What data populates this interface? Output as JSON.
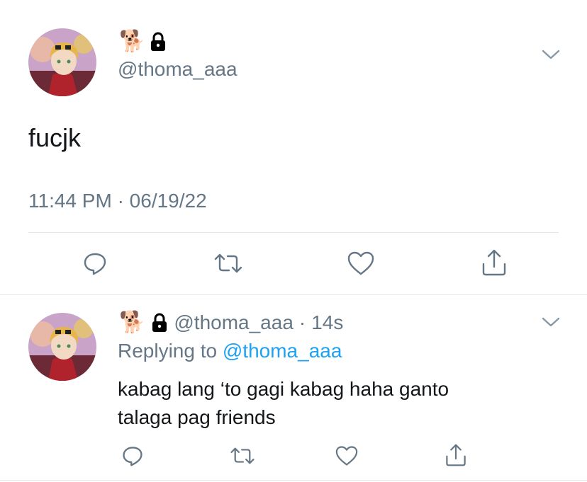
{
  "main_tweet": {
    "name_emoji": "🐕",
    "handle": "@thoma_aaa",
    "text": "fucjk",
    "time": "11:44 PM",
    "separator": "·",
    "date": "06/19/22"
  },
  "reply": {
    "name_emoji": "🐕",
    "handle": "@thoma_aaa",
    "dot": "·",
    "age": "14s",
    "replying_prefix": "Replying to",
    "replying_handle": "@thoma_aaa",
    "text_line1": "kabag lang ‘to gagi kabag haha ganto",
    "text_line2": "talaga pag friends"
  },
  "icons": {
    "reply": "reply-icon",
    "retweet": "retweet-icon",
    "like": "heart-icon",
    "share": "share-icon",
    "lock": "lock-icon",
    "menu": "chevron-down-icon"
  },
  "colors": {
    "text": "#14171a",
    "secondary": "#657786",
    "link": "#1da1f2",
    "divider": "#e1e8ed"
  }
}
